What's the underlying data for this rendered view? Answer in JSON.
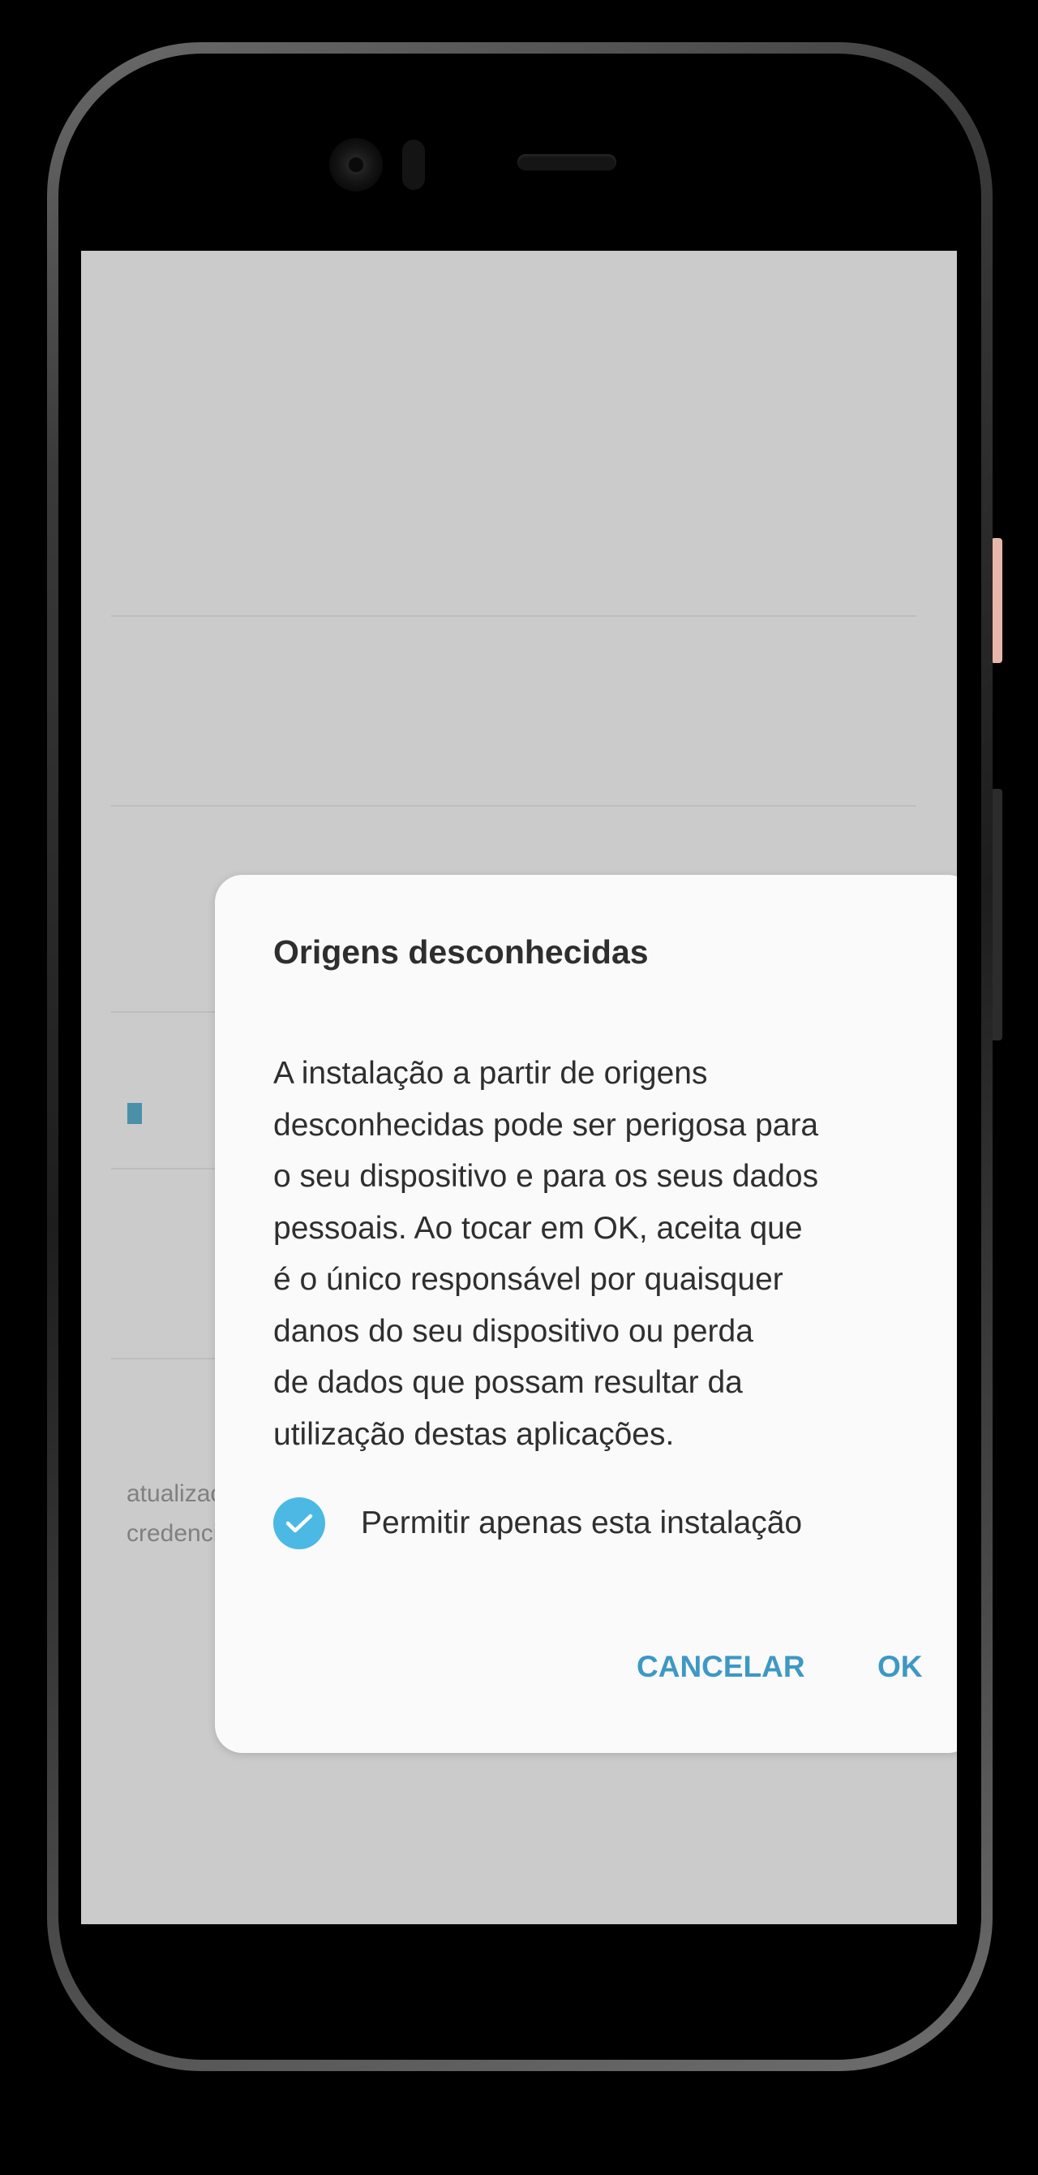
{
  "background_screen": {
    "footer_text_line1": "atualizações de segurança e do armazenamento de",
    "footer_text_line2": "credenciais."
  },
  "dialog": {
    "title": "Origens desconhecidas",
    "message": "A instalação a partir de origens\ndesconhecidas pode ser perigosa para\no seu dispositivo e para os seus dados\npessoais. Ao tocar em OK, aceita que\né o único responsável por quaisquer\ndanos do seu dispositivo ou perda\nde dados que possam resultar da\nutilização destas aplicações.",
    "checkbox_label": "Permitir apenas esta instalação",
    "checkbox_checked": true,
    "cancel_label": "CANCELAR",
    "ok_label": "OK"
  },
  "colors": {
    "accent": "#4bb9e3",
    "button_text": "#3e98c4",
    "scrim": "#cbcbcb"
  }
}
